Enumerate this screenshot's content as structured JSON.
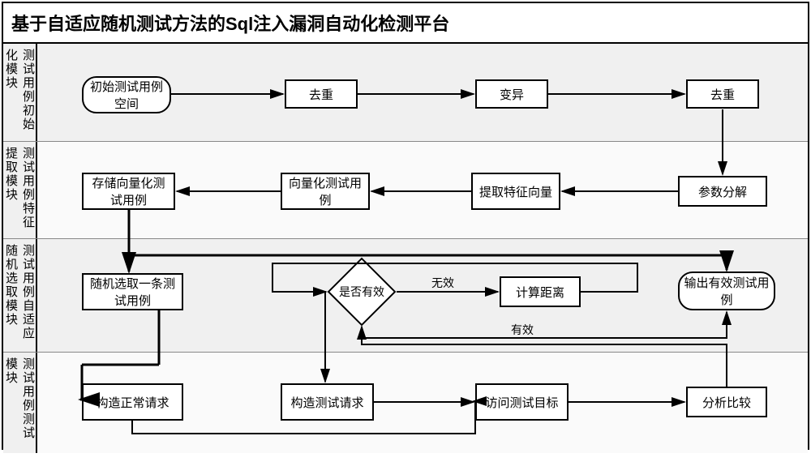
{
  "title": "基于自适应随机测试方法的Sql注入漏洞自动化检测平台",
  "lanes": {
    "l1": "测试用例初始化模块",
    "l2": "测试用例特征提取模块",
    "l3": "测试用例自适应随机选取模块",
    "l4": "测试用例测试模块"
  },
  "nodes": {
    "n_init_space": "初始测试用例空间",
    "n_dedup1": "去重",
    "n_mutate": "变异",
    "n_dedup2": "去重",
    "n_store_vec": "存储向量化测试用例",
    "n_vec_case": "向量化测试用例",
    "n_extract_feat": "提取特征向量",
    "n_param_decomp": "参数分解",
    "n_rand_pick": "随机选取一条测试用例",
    "n_valid": "是否有效",
    "n_calc_dist": "计算距离",
    "n_output": "输出有效测试用例",
    "n_build_normal": "构造正常请求",
    "n_build_test": "构造测试请求",
    "n_access": "访问测试目标",
    "n_analyze": "分析比较"
  },
  "edge_labels": {
    "invalid": "无效",
    "valid": "有效"
  }
}
